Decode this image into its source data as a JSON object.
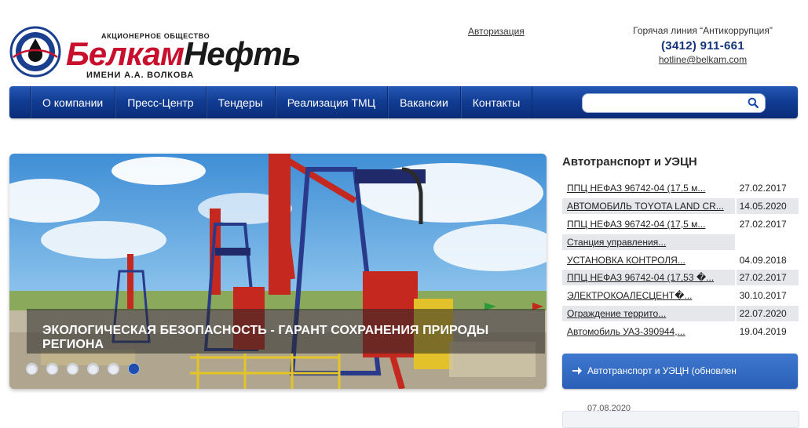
{
  "brand": {
    "tagline": "АКЦИОНЕРНОЕ ОБЩЕСТВО",
    "name_part1": "Белкам",
    "name_part2": "Нефть",
    "subname": "ИМЕНИ А.А. ВОЛКОВА"
  },
  "header": {
    "auth_link": "Авторизация",
    "hotline_title": "Горячая линия “Антикоррупция”",
    "hotline_phone": "(3412) 911-661",
    "hotline_email": "hotline@belkam.com"
  },
  "nav": {
    "items": [
      "О компании",
      "Пресс-Центр",
      "Тендеры",
      "Реализация ТМЦ",
      "Вакансии",
      "Контакты"
    ],
    "search_value": ""
  },
  "slider": {
    "caption": "ЭКОЛОГИЧЕСКАЯ БЕЗОПАСНОСТЬ - ГАРАНТ СОХРАНЕНИЯ ПРИРОДЫ РЕГИОНА",
    "dot_count": 6,
    "active_dot": 6
  },
  "sidebar": {
    "title": "Автотранспорт и УЭЦН",
    "rows": [
      {
        "title": "ППЦ НЕФАЗ 96742-04 (17,5 м...",
        "date": "27.02.2017"
      },
      {
        "title": "АВТОМОБИЛЬ TOYOTA LAND CR...",
        "date": "14.05.2020"
      },
      {
        "title": "ППЦ НЕФАЗ 96742-04 (17,5 м...",
        "date": "27.02.2017"
      },
      {
        "title": "Станция управления...",
        "date": ""
      },
      {
        "title": "УСТАНОВКА КОНТРОЛЯ...",
        "date": "04.09.2018"
      },
      {
        "title": "ППЦ НЕФАЗ 96742-04 (17,53 �...",
        "date": "27.02.2017"
      },
      {
        "title": "ЭЛЕКТРОКОАЛЕСЦЕНТ�...",
        "date": "30.10.2017"
      },
      {
        "title": "Ограждение террито...",
        "date": "22.07.2020"
      },
      {
        "title": "Автомобиль УАЗ-390944,...",
        "date": "19.04.2019"
      }
    ],
    "feed_button": "Автотранспорт и УЭЦН (обновлен",
    "next_date": "07.08.2020"
  },
  "colors": {
    "brand_red": "#c8102e",
    "nav_blue": "#123d94",
    "phone_blue": "#14337a"
  }
}
